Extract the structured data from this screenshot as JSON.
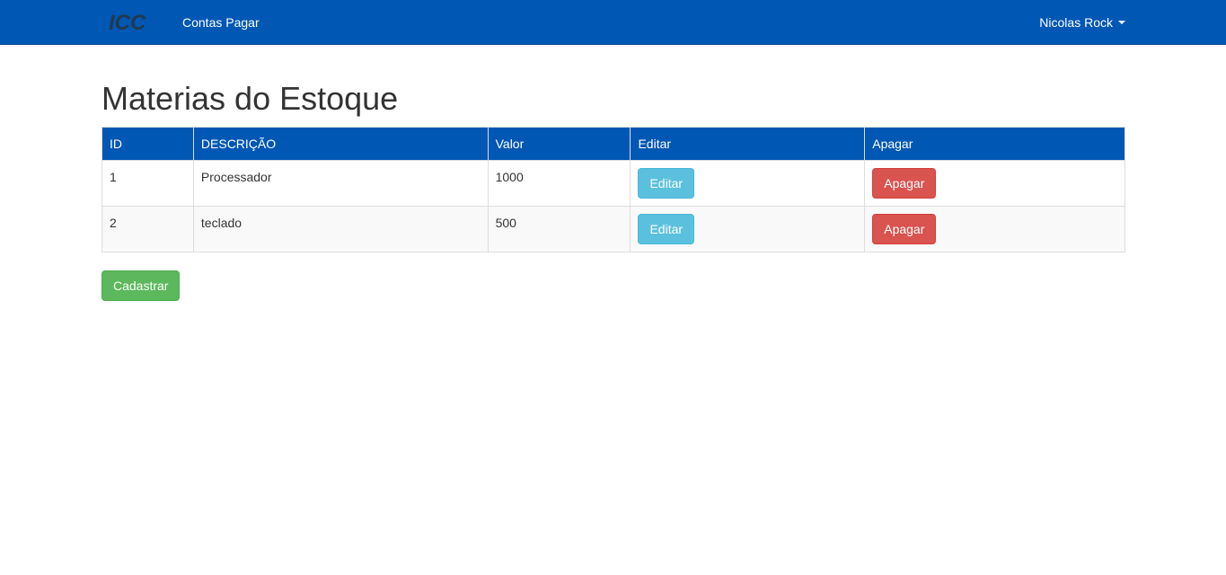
{
  "navbar": {
    "brand_logo_text": "ICC",
    "link_label": "Contas Pagar",
    "user_name": "Nicolas Rock",
    "bg_color": "#0157b4"
  },
  "page": {
    "title": "Materias do Estoque"
  },
  "table": {
    "headers": [
      "ID",
      "DESCRIÇÃO",
      "Valor",
      "Editar",
      "Apagar"
    ],
    "rows": [
      {
        "id": "1",
        "descricao": "Processador",
        "valor": "1000",
        "edit_label": "Editar",
        "delete_label": "Apagar"
      },
      {
        "id": "2",
        "descricao": "teclado",
        "valor": "500",
        "edit_label": "Editar",
        "delete_label": "Apagar"
      }
    ]
  },
  "actions": {
    "cadastrar_label": "Cadastrar"
  },
  "colors": {
    "header_bg": "#0157b4",
    "edit_button": "#5bc0de",
    "delete_button": "#d9534f",
    "create_button": "#5cb85c"
  }
}
